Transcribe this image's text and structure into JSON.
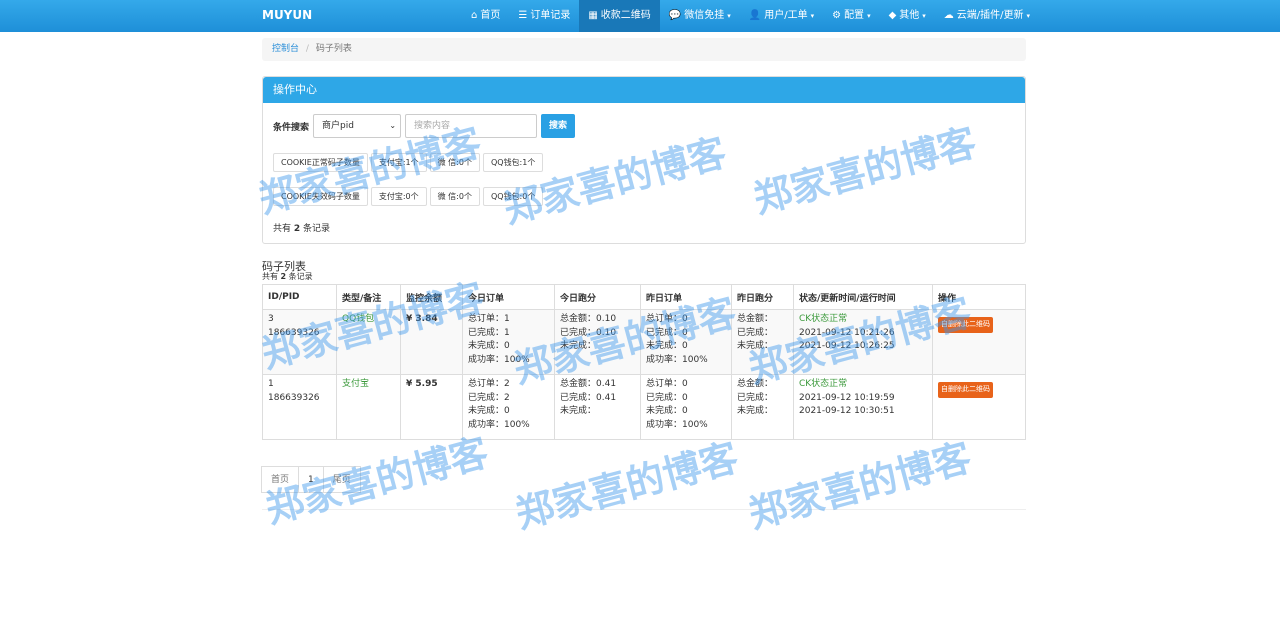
{
  "brand": "MUYUN",
  "nav": [
    {
      "label": "首页",
      "icon": "home-icon",
      "glyph": "⌂",
      "caret": ""
    },
    {
      "label": "订单记录",
      "icon": "list-icon",
      "glyph": "☰",
      "caret": ""
    },
    {
      "label": "收款二维码",
      "icon": "qrcode-icon",
      "glyph": "▦",
      "caret": ""
    },
    {
      "label": "微信免挂",
      "icon": "wechat-icon",
      "glyph": "💬",
      "caret": "▾"
    },
    {
      "label": "用户/工单",
      "icon": "user-icon",
      "glyph": "👤",
      "caret": "▾"
    },
    {
      "label": "配置",
      "icon": "gear-icon",
      "glyph": "⚙",
      "caret": "▾"
    },
    {
      "label": "其他",
      "icon": "cube-icon",
      "glyph": "◆",
      "caret": "▾"
    },
    {
      "label": "云端/插件/更新",
      "icon": "cloud-icon",
      "glyph": "☁",
      "caret": "▾"
    }
  ],
  "breadcrumb": {
    "home": "控制台",
    "sep": "/",
    "current": "码子列表"
  },
  "panel": {
    "title": "操作中心",
    "search_label": "条件搜索",
    "select_value": "商户pid",
    "search_placeholder": "搜索内容",
    "search_button": "搜索",
    "cookie_ok": [
      "COOKIE正常码子数量",
      "支付宝:1个",
      "微 信:0个",
      "QQ钱包:1个"
    ],
    "cookie_bad": [
      "COOKIE失效码子数量",
      "支付宝:0个",
      "微 信:0个",
      "QQ钱包:0个"
    ],
    "count_prefix": "共有 ",
    "count_num": "2",
    "count_suffix": " 条记录"
  },
  "list": {
    "title": "码子列表",
    "count_prefix": "共有 ",
    "count_num": "2",
    "count_suffix": " 条记录"
  },
  "table": {
    "headers": [
      "ID/PID",
      "类型/备注",
      "监控余额",
      "今日订单",
      "今日跑分",
      "昨日订单",
      "昨日跑分",
      "状态/更新时间/运行时间",
      "操作"
    ],
    "rows": [
      {
        "id": "3",
        "pid": "186639326",
        "type": "QQ钱包",
        "balance": "¥ 3.84",
        "today_orders": [
          "总订单：1",
          "已完成：1",
          "未完成：0",
          "成功率：100%"
        ],
        "today_score": [
          "总金额：0.10",
          "已完成：0.10",
          "未完成："
        ],
        "yest_orders": [
          "总订单：0",
          "已完成：0",
          "未完成：0",
          "成功率：100%"
        ],
        "yest_score": [
          "总金额：",
          "已完成：",
          "未完成："
        ],
        "status": "CK状态正常",
        "updated": "2021-09-12 10:21:26",
        "running": "2021-09-12 10:26:25",
        "action": "自删除此二维码"
      },
      {
        "id": "1",
        "pid": "186639326",
        "type": "支付宝",
        "balance": "¥ 5.95",
        "today_orders": [
          "总订单：2",
          "已完成：2",
          "未完成：0",
          "成功率：100%"
        ],
        "today_score": [
          "总金额：0.41",
          "已完成：0.41",
          "未完成："
        ],
        "yest_orders": [
          "总订单：0",
          "已完成：0",
          "未完成：0",
          "成功率：100%"
        ],
        "yest_score": [
          "总金额：",
          "已完成：",
          "未完成："
        ],
        "status": "CK状态正常",
        "updated": "2021-09-12 10:19:59",
        "running": "2021-09-12 10:30:51",
        "action": "自删除此二维码"
      }
    ]
  },
  "pager": {
    "first": "首页",
    "page": "1",
    "last": "尾页"
  },
  "watermark": "郑家喜的博客",
  "colors": {
    "accent": "#2ea7e7",
    "green": "#3c9a3c",
    "danger": "#e8631a"
  }
}
